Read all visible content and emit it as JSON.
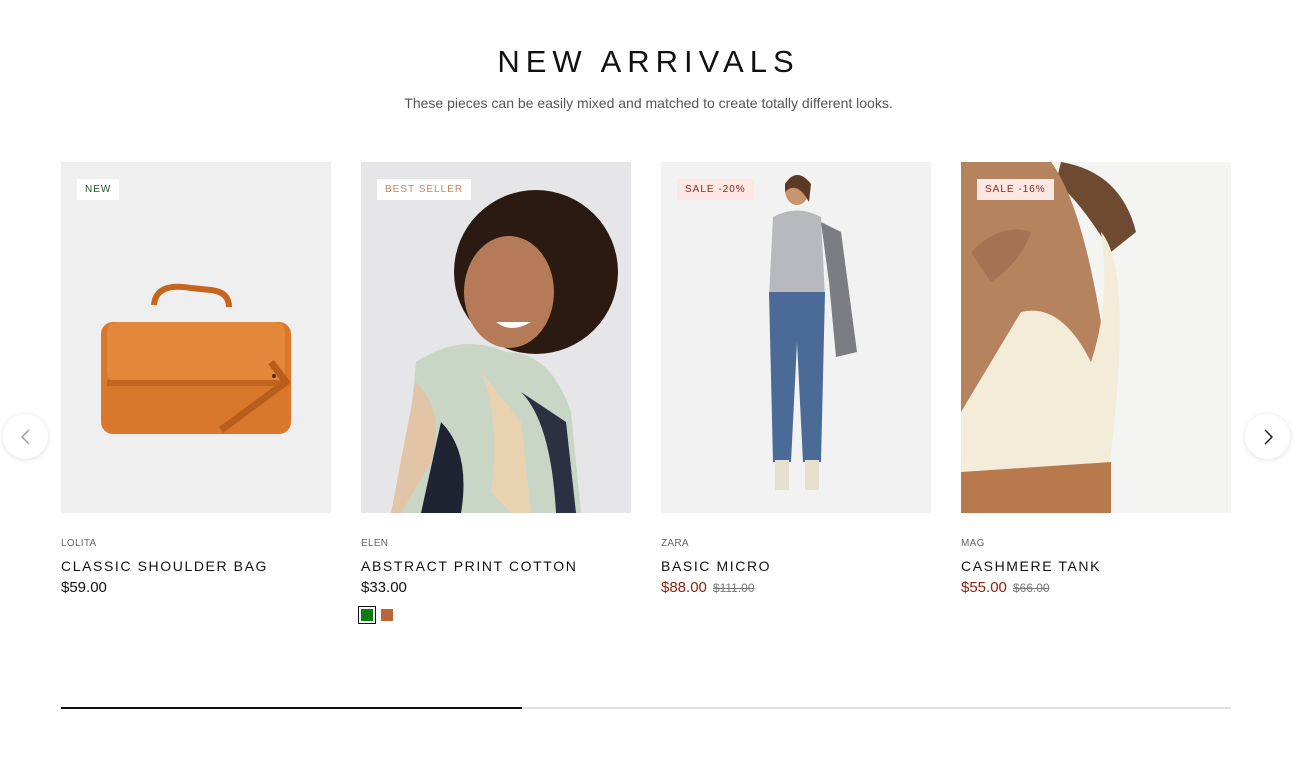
{
  "section": {
    "title": "NEW ARRIVALS",
    "subtitle": "These pieces can be easily mixed and matched to create totally different looks."
  },
  "products": [
    {
      "badge": "NEW",
      "vendor": "LOLITA",
      "name": "CLASSIC SHOULDER BAG",
      "price": "$59.00",
      "image_icon": "orange-shoulder-bag-image"
    },
    {
      "badge": "BEST SELLER",
      "vendor": "ELEN",
      "name": "ABSTRACT PRINT COTTON",
      "price": "$33.00",
      "image_icon": "woman-abstract-print-shirt-image",
      "swatches": [
        {
          "name": "green",
          "color": "#0a7d12",
          "selected": true
        },
        {
          "name": "brown",
          "color": "#b8653a",
          "selected": false
        }
      ]
    },
    {
      "badge": "SALE -20%",
      "vendor": "ZARA",
      "name": "BASIC MICRO",
      "price": "$88.00",
      "compare_price": "$111.00",
      "image_icon": "woman-jeans-grey-top-image"
    },
    {
      "badge": "SALE -16%",
      "vendor": "MAG",
      "name": "CASHMERE TANK",
      "price": "$55.00",
      "compare_price": "$66.00",
      "image_icon": "woman-cream-tank-image"
    }
  ],
  "carousel": {
    "prev_icon": "chevron-left-icon",
    "next_icon": "chevron-right-icon",
    "progress_fraction": 0.394
  },
  "colors": {
    "sale_price": "#8a1f12",
    "sale_badge_bg": "#fde7e3",
    "new_badge_text": "#1e5a2c",
    "best_seller_badge_text": "#c6865a"
  }
}
